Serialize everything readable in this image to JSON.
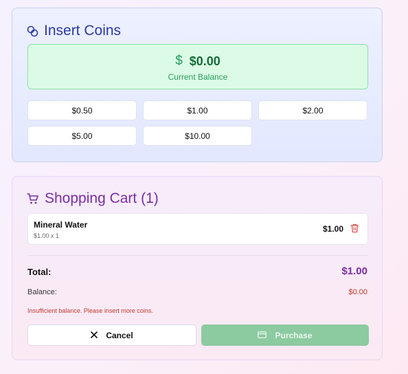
{
  "coins_panel": {
    "title": "Insert Coins",
    "icon": "coins-icon",
    "balance": {
      "amount": "$0.00",
      "label": "Current Balance",
      "icon": "dollar-icon",
      "symbol": "$"
    },
    "coin_buttons": [
      "$0.50",
      "$1.00",
      "$2.00",
      "$5.00",
      "$10.00"
    ]
  },
  "cart_panel": {
    "title": "Shopping Cart (1)",
    "icon": "shopping-cart-icon",
    "items": [
      {
        "name": "Mineral Water",
        "detail": "$1.00 x 1",
        "price": "$1.00"
      }
    ],
    "total_label": "Total:",
    "total_value": "$1.00",
    "balance_label": "Balance:",
    "balance_value": "$0.00",
    "warning": "Insufficient balance. Please insert more coins.",
    "cancel_label": "Cancel",
    "purchase_label": "Purchase"
  },
  "colors": {
    "coins_accent": "#2b3aa6",
    "cart_accent": "#7b2ea3",
    "balance_green": "#146c3a",
    "warning_red": "#c0392b",
    "purchase_disabled": "#8ccaa0"
  }
}
